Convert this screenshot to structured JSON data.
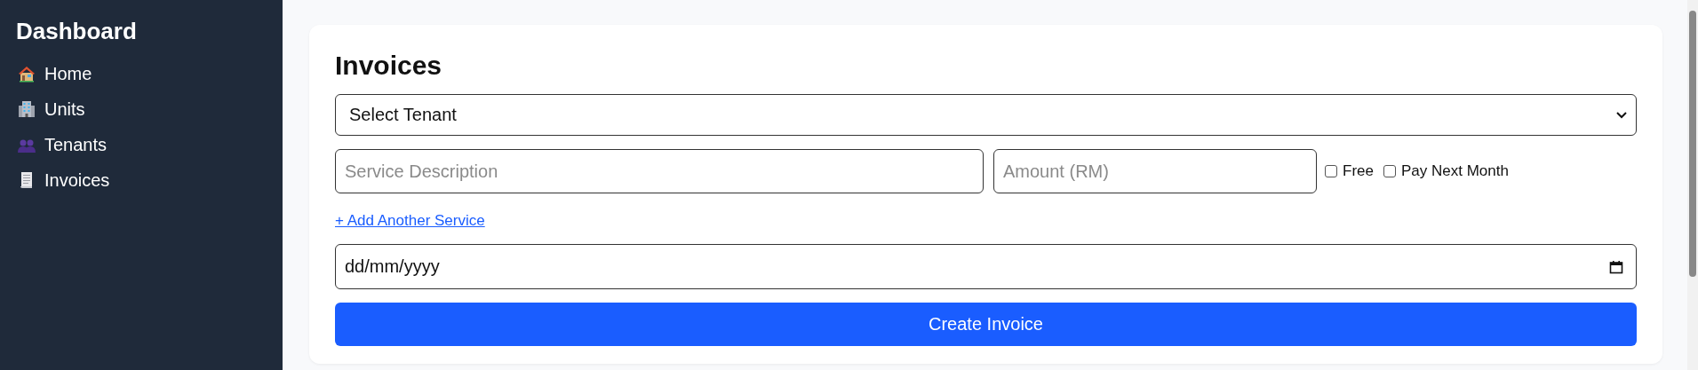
{
  "sidebar": {
    "title": "Dashboard",
    "items": [
      {
        "kind": "house",
        "label": "Home",
        "selected": false
      },
      {
        "kind": "building",
        "label": "Units",
        "selected": false
      },
      {
        "kind": "people",
        "label": "Tenants",
        "selected": false
      },
      {
        "kind": "receipt",
        "label": "Invoices",
        "selected": false
      }
    ]
  },
  "form": {
    "title": "Invoices",
    "tenant_select": {
      "value": "Select Tenant"
    },
    "service_rows": [
      {
        "description": {
          "placeholder": "Service Description"
        },
        "amount": {
          "placeholder": "Amount (RM)"
        },
        "options": [
          {
            "label": "Free",
            "checked": false
          },
          {
            "label": "Pay Next Month",
            "checked": false
          }
        ]
      }
    ],
    "add_service_link": "+ Add Another Service",
    "date_field": {
      "value": "dd/mm/yyyy"
    },
    "submit_button": "Create Invoice"
  }
}
